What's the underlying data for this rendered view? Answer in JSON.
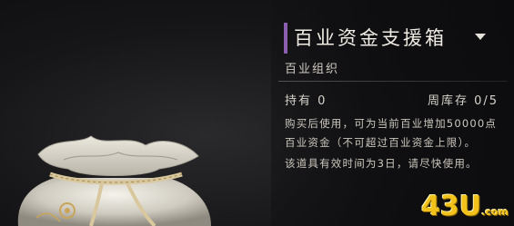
{
  "item": {
    "name": "百业资金支援箱",
    "category": "百业组织",
    "hold_label": "持有 0",
    "stock_label": "周库存 0/5",
    "description": [
      "购买后使用，可为当前百业增加50000点百业资金（不可超过百业资金上限）。",
      "该道具有效时间为3日，请尽快使用。"
    ],
    "accent_color": "#8b5fb0"
  },
  "watermark": {
    "main": "43U",
    "suffix": ".com"
  }
}
